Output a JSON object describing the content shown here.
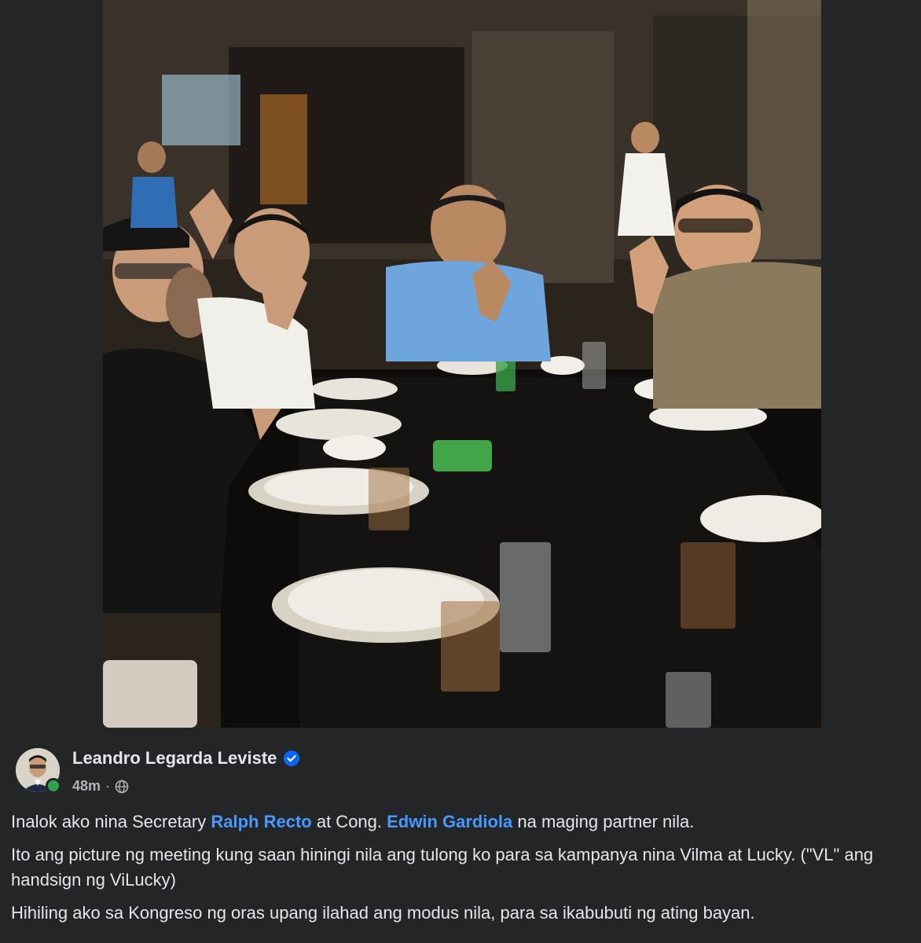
{
  "post": {
    "author": "Leandro Legarda Leviste",
    "timestamp": "48m",
    "separator": "·",
    "audience_icon": "globe-icon",
    "verified_icon": "verified-badge-icon",
    "paragraph1": {
      "pre": "Inalok ako nina Secretary ",
      "mention1": "Ralph Recto",
      "mid": " at Cong. ",
      "mention2": "Edwin Gardiola",
      "post": " na maging partner nila."
    },
    "paragraph2": "Ito ang picture ng meeting kung saan hiningi nila ang tulong ko para sa kampanya nina Vilma at Lucky. (\"VL\" ang handsign ng ViLucky)",
    "paragraph3": "Hihiling ako sa Kongreso ng oras upang ilahad ang modus nila, para sa ikabubuti ng ating bayan."
  },
  "colors": {
    "background": "#242526",
    "text": "#e4e6eb",
    "secondary_text": "#b0b3b8",
    "mention": "#4599ff",
    "verified": "#0866ff",
    "online": "#31a24c"
  }
}
